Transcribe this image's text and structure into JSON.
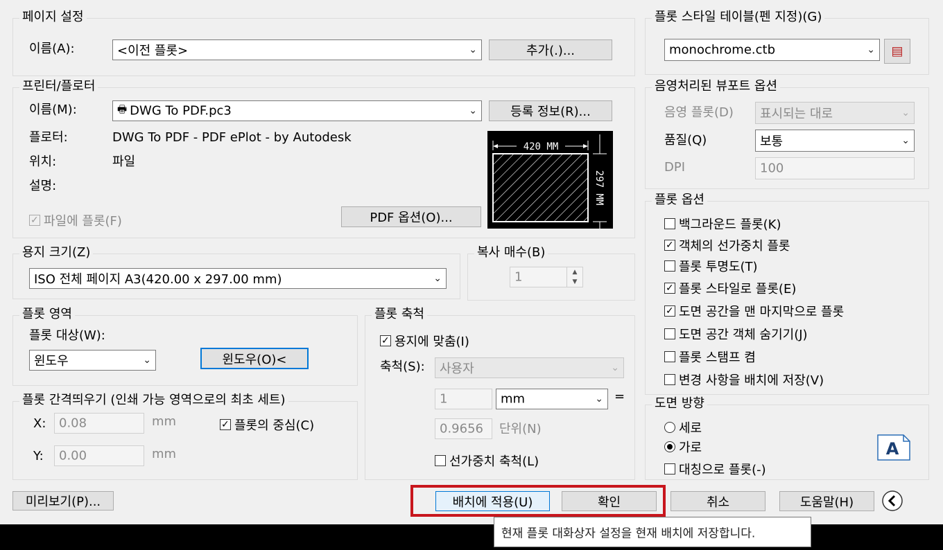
{
  "page_setup": {
    "title": "페이지 설정",
    "name_label": "이름(A):",
    "name_value": "<이전 플롯>",
    "add_button": "추가(.)..."
  },
  "printer": {
    "title": "프린터/플로터",
    "name_label": "이름(M):",
    "name_value": "DWG To PDF.pc3",
    "properties_button": "등록 정보(R)...",
    "plotter_label": "플로터:",
    "plotter_value": "DWG To PDF - PDF ePlot - by Autodesk",
    "location_label": "위치:",
    "location_value": "파일",
    "description_label": "설명:",
    "plot_to_file": "파일에 플롯(F)",
    "plot_to_file_checked": true,
    "pdf_options_button": "PDF 옵션(O)...",
    "preview_width_label": "420 MM",
    "preview_height_label": "297 MM"
  },
  "paper_size": {
    "title": "용지 크기(Z)",
    "value": "ISO 전체 페이지 A3(420.00 x 297.00 mm)"
  },
  "copies": {
    "title": "복사 매수(B)",
    "value": "1"
  },
  "plot_area": {
    "title": "플롯 영역",
    "what_label": "플롯 대상(W):",
    "what_value": "윈도우",
    "window_button": "윈도우(O)<"
  },
  "plot_scale": {
    "title": "플롯 축척",
    "fit_to_paper": "용지에 맞춤(I)",
    "fit_checked": true,
    "scale_label": "축척(S):",
    "scale_value": "사용자",
    "value1": "1",
    "unit_value": "mm",
    "equals": "=",
    "value2": "0.9656",
    "unit_label": "단위(N)",
    "scale_lineweights": "선가중치 축척(L)",
    "scale_lineweights_checked": false
  },
  "plot_offset": {
    "title": "플롯 간격띄우기 (인쇄 가능 영역으로의 최초 세트)",
    "x_label": "X:",
    "x_value": "0.08",
    "y_label": "Y:",
    "y_value": "0.00",
    "unit": "mm",
    "center_plot": "플롯의 중심(C)",
    "center_checked": true
  },
  "plot_style_table": {
    "title": "플롯 스타일 테이블(펜 지정)(G)",
    "value": "monochrome.ctb"
  },
  "shaded_viewport": {
    "title": "음영처리된 뷰포트 옵션",
    "shade_label": "음영 플롯(D)",
    "shade_value": "표시되는 대로",
    "quality_label": "품질(Q)",
    "quality_value": "보통",
    "dpi_label": "DPI",
    "dpi_value": "100"
  },
  "plot_options": {
    "title": "플롯 옵션",
    "items": [
      {
        "label": "백그라운드 플롯(K)",
        "checked": false
      },
      {
        "label": "객체의 선가중치 플롯",
        "checked": true
      },
      {
        "label": "플롯 투명도(T)",
        "checked": false
      },
      {
        "label": "플롯 스타일로 플롯(E)",
        "checked": true
      },
      {
        "label": "도면 공간을 맨 마지막으로 플롯",
        "checked": true
      },
      {
        "label": "도면 공간 객체 숨기기(J)",
        "checked": false
      },
      {
        "label": "플롯 스탬프 켬",
        "checked": false
      },
      {
        "label": "변경 사항을 배치에 저장(V)",
        "checked": false
      }
    ]
  },
  "orientation": {
    "title": "도면 방향",
    "portrait": "세로",
    "landscape": "가로",
    "selected": "landscape",
    "upside_down": "대칭으로 플롯(-)",
    "upside_down_checked": false,
    "icon_letter": "A"
  },
  "footer": {
    "preview_button": "미리보기(P)...",
    "apply_button": "배치에 적용(U)",
    "ok_button": "확인",
    "cancel_button": "취소",
    "help_button": "도움말(H)",
    "tooltip": "현재 플롯 대화상자 설정을 현재 배치에 저장합니다."
  },
  "colors": {
    "highlight_box": "#c8161d",
    "focus_border": "#0078d7"
  }
}
